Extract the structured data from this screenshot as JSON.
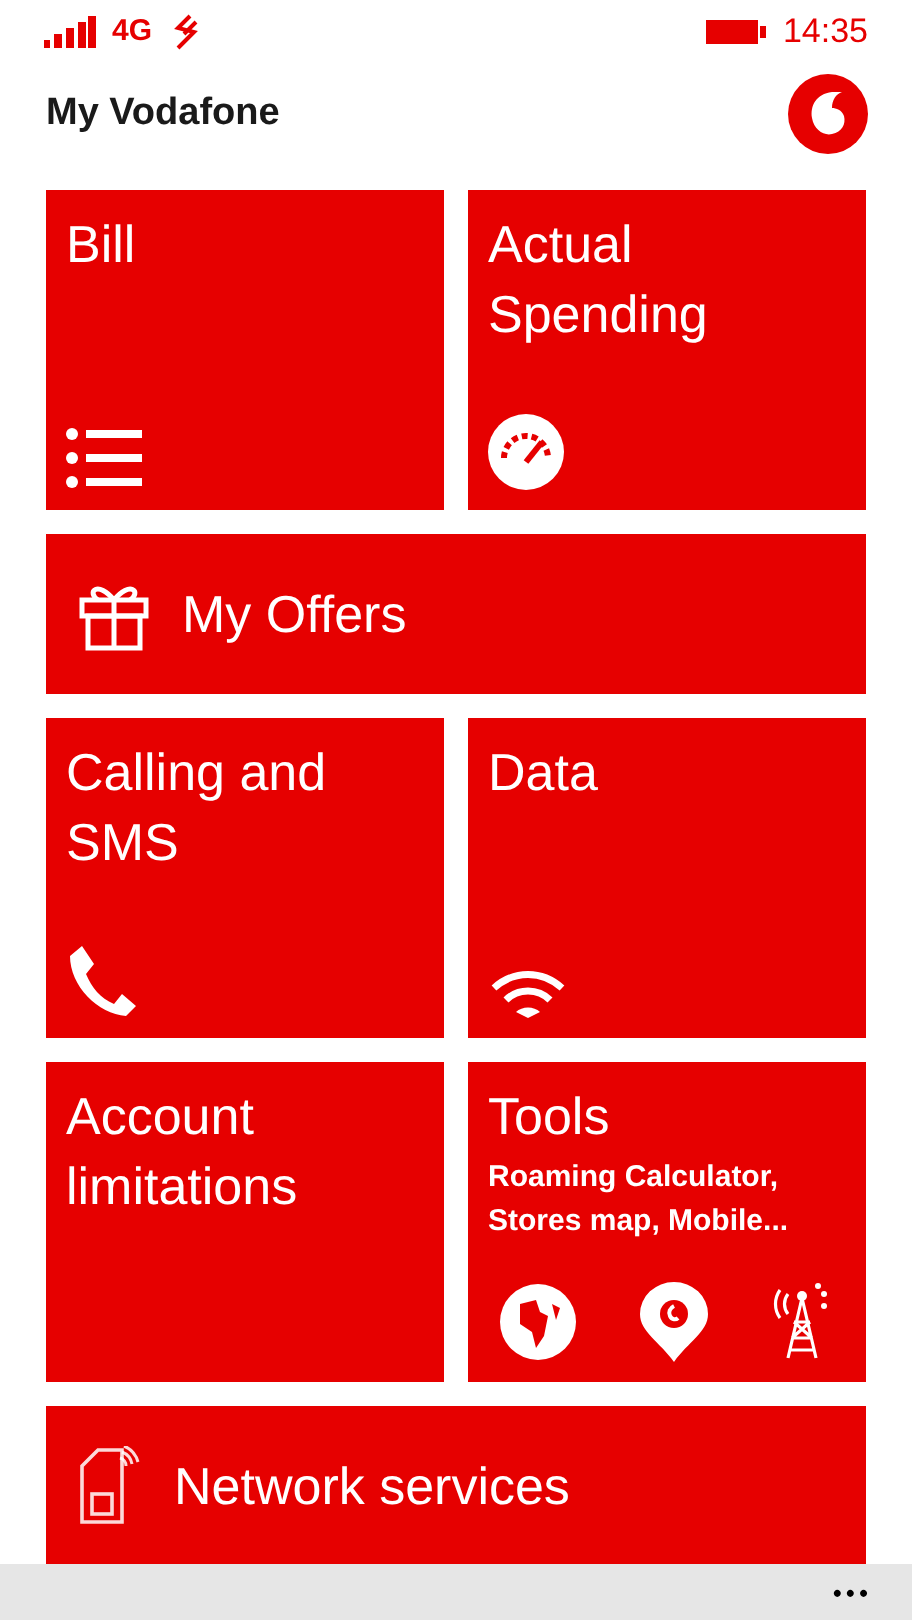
{
  "status_bar": {
    "network": "4G",
    "time": "14:35"
  },
  "header": {
    "title": "My Vodafone"
  },
  "tiles": [
    {
      "kind": "square",
      "title": "Bill"
    },
    {
      "kind": "square",
      "title": "Actual Spending"
    },
    {
      "kind": "wide",
      "title": "My Offers"
    },
    {
      "kind": "square",
      "title": "Calling and SMS"
    },
    {
      "kind": "square",
      "title": "Data"
    },
    {
      "kind": "square",
      "title": "Account limitations"
    },
    {
      "kind": "square",
      "title": "Tools",
      "subtitle": "Roaming Calculator, Stores map, Mobile..."
    },
    {
      "kind": "wide",
      "title": "Network services"
    }
  ],
  "app_bar": {
    "more": "•••"
  }
}
